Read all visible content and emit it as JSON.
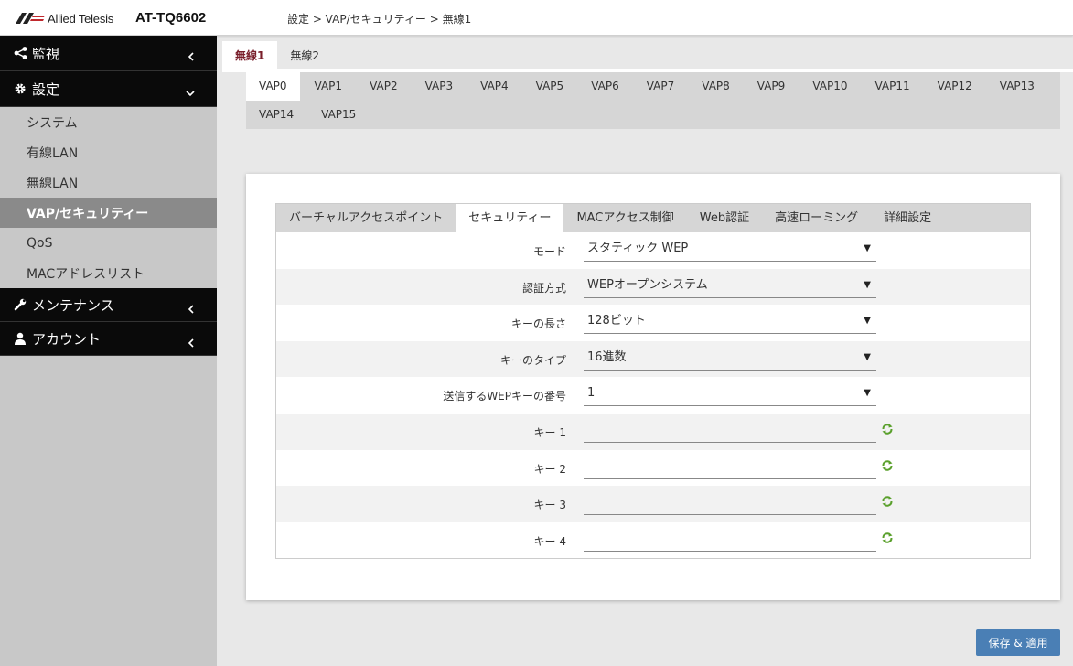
{
  "header": {
    "logo_text": "Allied Telesis",
    "model": "AT-TQ6602",
    "breadcrumb": "設定 > VAP/セキュリティー > 無線1"
  },
  "sidebar": {
    "monitor": "監視",
    "settings": "設定",
    "settings_items": [
      "システム",
      "有線LAN",
      "無線LAN",
      "VAP/セキュリティー",
      "QoS",
      "MACアドレスリスト"
    ],
    "maintenance": "メンテナンス",
    "account": "アカウント"
  },
  "wireless_tabs": [
    "無線1",
    "無線2"
  ],
  "vap_tabs": [
    "VAP0",
    "VAP1",
    "VAP2",
    "VAP3",
    "VAP4",
    "VAP5",
    "VAP6",
    "VAP7",
    "VAP8",
    "VAP9",
    "VAP10",
    "VAP11",
    "VAP12",
    "VAP13",
    "VAP14",
    "VAP15"
  ],
  "section_tabs": [
    "バーチャルアクセスポイント",
    "セキュリティー",
    "MACアクセス制御",
    "Web認証",
    "高速ローミング",
    "詳細設定"
  ],
  "form": {
    "mode_label": "モード",
    "mode_value": "スタティック WEP",
    "auth_label": "認証方式",
    "auth_value": "WEPオープンシステム",
    "keylen_label": "キーの長さ",
    "keylen_value": "128ビット",
    "keytype_label": "キーのタイプ",
    "keytype_value": "16進数",
    "txkey_label": "送信するWEPキーの番号",
    "txkey_value": "1",
    "key1_label": "キー 1",
    "key2_label": "キー 2",
    "key3_label": "キー 3",
    "key4_label": "キー 4"
  },
  "save_button": "保存 & 適用",
  "colors": {
    "accent": "#4a7fb5",
    "active_wireless_tab": "#7a1f2b",
    "nav_dark": "#0a0a0a",
    "generate_icon": "#5aa02c"
  }
}
